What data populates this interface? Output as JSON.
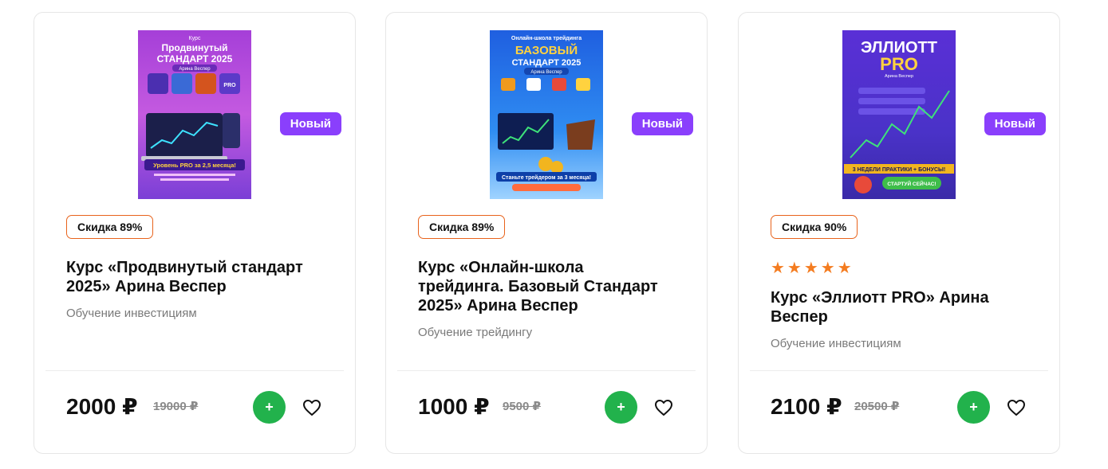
{
  "colors": {
    "badge_new": "#8a3ffc",
    "discount_border": "#e8631c",
    "add_button": "#22b24c",
    "star": "#f47c20"
  },
  "products": [
    {
      "cover": {
        "top": "Курс",
        "title_line1": "Продвинутый",
        "title_line2": "СТАНДАРТ 2025",
        "author": "Арина Веспер",
        "banner": "Уровень PRO за 2,5 месяца!",
        "icons": [
          "chart-icon",
          "gear-icon",
          "coin-icon",
          "pro-icon"
        ]
      },
      "badge": "Новый",
      "discount": "Скидка 89%",
      "rating": "",
      "title": "Курс «Продвинутый стандарт 2025» Арина Веспер",
      "category": "Обучение инвестициям",
      "price": "2000 ₽",
      "old_price": "19000 ₽"
    },
    {
      "cover": {
        "top": "Онлайн-школа трейдинга",
        "title_line1": "БАЗОВЫЙ",
        "title_line2": "СТАНДАРТ 2025",
        "author": "Арина Веспер",
        "banner": "Станьте трейдером за 3 месяца!",
        "icons": [
          "chart-icon",
          "shield-icon",
          "calendar-icon",
          "growth-icon"
        ]
      },
      "badge": "Новый",
      "discount": "Скидка 89%",
      "rating": "",
      "title": "Курс «Онлайн-школа трейдинга. Базовый Стандарт 2025» Арина Веспер",
      "category": "Обучение трейдингу",
      "price": "1000 ₽",
      "old_price": "9500 ₽"
    },
    {
      "cover": {
        "top": "",
        "title_line1": "ЭЛЛИОТТ",
        "title_line2": "PRO",
        "author": "Арина Веспер",
        "banner": "3 НЕДЕЛИ ПРАКТИКИ + БОНУСЫ!",
        "cta": "СТАРТУЙ СЕЙЧАС!",
        "icons": []
      },
      "badge": "Новый",
      "discount": "Скидка 90%",
      "rating": "★★★★★",
      "title": "Курс «Эллиотт PRO» Арина Веспер",
      "category": "Обучение инвестициям",
      "price": "2100 ₽",
      "old_price": "20500 ₽"
    }
  ]
}
